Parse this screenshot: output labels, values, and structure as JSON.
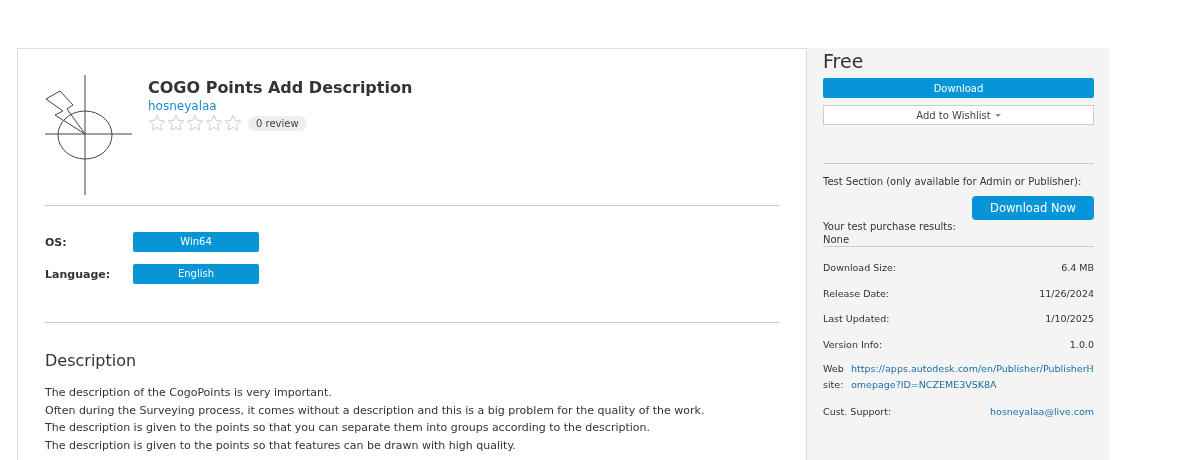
{
  "product": {
    "title": "COGO Points Add Description",
    "author": "hosneyalaa",
    "stars": 0,
    "review_count": "0 review"
  },
  "attributes": [
    {
      "label": "OS:",
      "value": "Win64"
    },
    {
      "label": "Language:",
      "value": "English"
    }
  ],
  "description": {
    "heading": "Description",
    "lines": [
      "The description of the CogoPoints is very important.",
      "Often during the Surveying process, it comes without a description and this is a big problem for the quality of the work.",
      "The description is given to the points so that you can separate them into groups according to the description.",
      "The description is given to the points so that features can be drawn with high quality."
    ]
  },
  "sidebar": {
    "price": "Free",
    "download_button": "Download",
    "wishlist_button": "Add to Wishlist",
    "test_section": {
      "title": "Test Section (only available for Admin or Publisher):",
      "button": "Download Now",
      "results_label": "Your test purchase results:",
      "results_value": "None"
    },
    "details": [
      {
        "kind": "text",
        "label": "Download Size:",
        "value": "6.4 MB"
      },
      {
        "kind": "text",
        "label": "Release Date:",
        "value": "11/26/2024"
      },
      {
        "kind": "text",
        "label": "Last Updated:",
        "value": "1/10/2025"
      },
      {
        "kind": "text",
        "label": "Version Info:",
        "value": "1.0.0"
      },
      {
        "kind": "website",
        "label": "Web site:",
        "value": "https://apps.autodesk.com/en/Publisher/PublisherHomepage?ID=NCZEME3VSK8A"
      },
      {
        "kind": "link",
        "label": "Cust. Support:",
        "value": "hosneyalaa@live.com"
      }
    ]
  }
}
